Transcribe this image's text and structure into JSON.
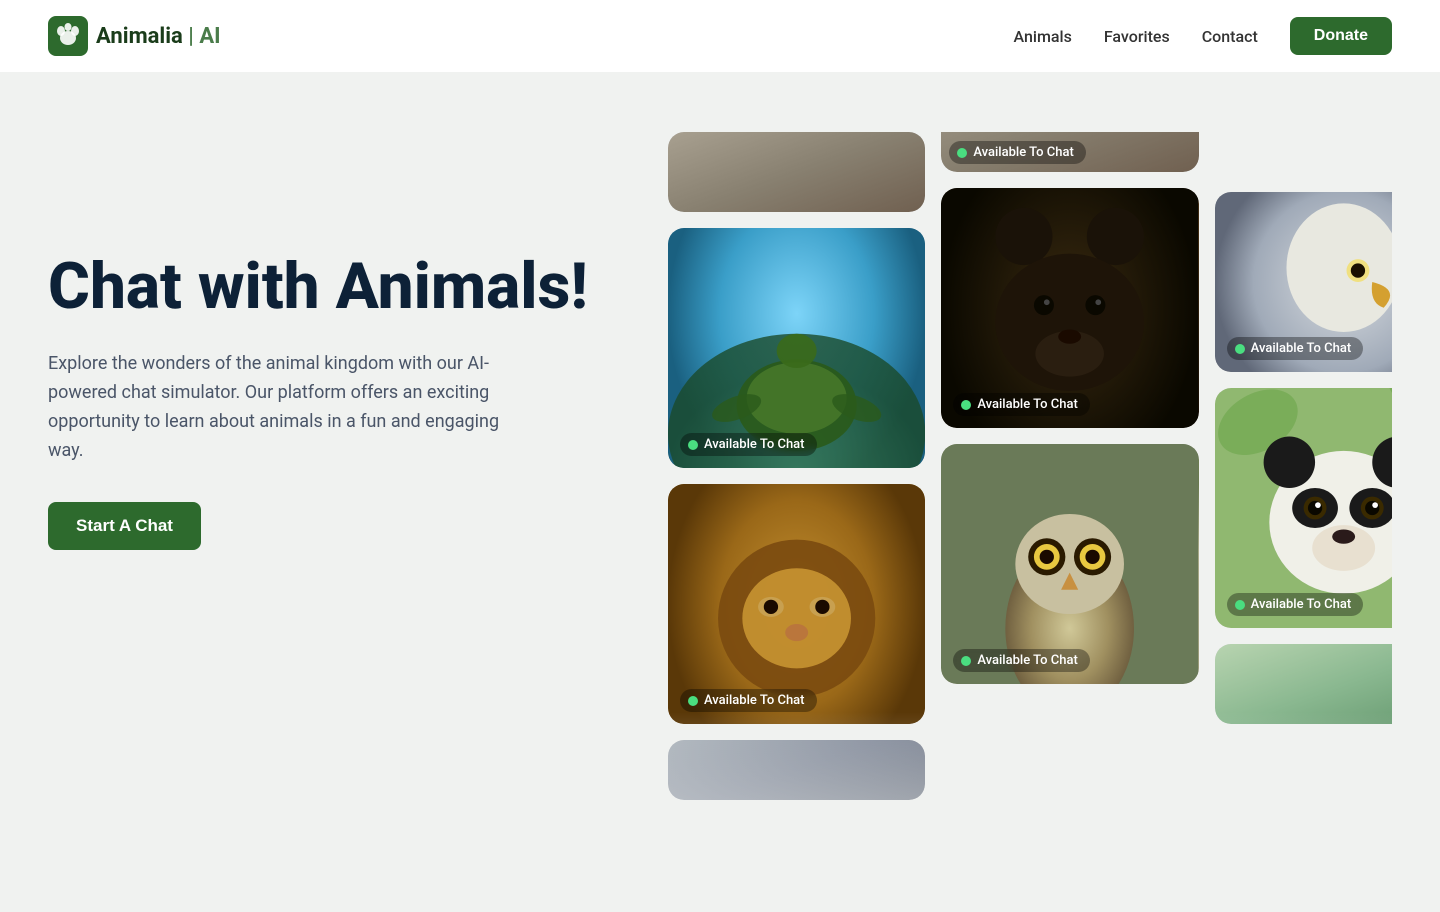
{
  "header": {
    "logo_name": "Animalia",
    "logo_suffix": " | AI",
    "nav_items": [
      {
        "label": "Animals",
        "id": "animals"
      },
      {
        "label": "Favorites",
        "id": "favorites"
      },
      {
        "label": "Contact",
        "id": "contact"
      }
    ],
    "donate_label": "Donate"
  },
  "hero": {
    "heading": "Chat with Animals!",
    "description": "Explore the wonders of the animal kingdom with our AI-powered chat simulator. Our platform offers an exciting opportunity to learn about animals in a fun and engaging way.",
    "cta_label": "Start A Chat"
  },
  "status": {
    "available_text": "Available To Chat"
  },
  "colors": {
    "primary_green": "#2d6a2d",
    "status_green": "#4ade80",
    "heading_dark": "#0d2137"
  }
}
